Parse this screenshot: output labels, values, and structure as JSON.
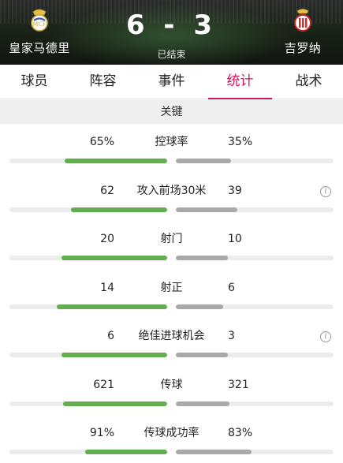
{
  "match": {
    "home_team": "皇家马德里",
    "away_team": "吉罗纳",
    "score": "6 - 3",
    "status": "已结束"
  },
  "icons": {
    "home_crest": "real-madrid-crest-icon",
    "away_crest": "girona-crest-icon",
    "info": "info-icon"
  },
  "colors": {
    "active_tab": "#d4145a",
    "home_bar": "#62ad4f",
    "away_bar": "#a9a9ab",
    "track": "#ececec"
  },
  "tabs": [
    {
      "label": "球员",
      "active": false
    },
    {
      "label": "阵容",
      "active": false
    },
    {
      "label": "事件",
      "active": false
    },
    {
      "label": "统计",
      "active": true
    },
    {
      "label": "战术",
      "active": false
    }
  ],
  "section_title": "关键",
  "stats": [
    {
      "label": "控球率",
      "home": "65%",
      "away": "35%",
      "home_fill": 0.65,
      "away_fill": 0.35,
      "info": false
    },
    {
      "label": "攻入前场30米",
      "home": "62",
      "away": "39",
      "home_fill": 0.61,
      "away_fill": 0.39,
      "info": true
    },
    {
      "label": "射门",
      "home": "20",
      "away": "10",
      "home_fill": 0.67,
      "away_fill": 0.33,
      "info": false
    },
    {
      "label": "射正",
      "home": "14",
      "away": "6",
      "home_fill": 0.7,
      "away_fill": 0.3,
      "info": false
    },
    {
      "label": "绝佳进球机会",
      "home": "6",
      "away": "3",
      "home_fill": 0.67,
      "away_fill": 0.33,
      "info": true
    },
    {
      "label": "传球",
      "home": "621",
      "away": "321",
      "home_fill": 0.66,
      "away_fill": 0.34,
      "info": false
    },
    {
      "label": "传球成功率",
      "home": "91%",
      "away": "83%",
      "home_fill": 0.52,
      "away_fill": 0.48,
      "info": false
    }
  ]
}
